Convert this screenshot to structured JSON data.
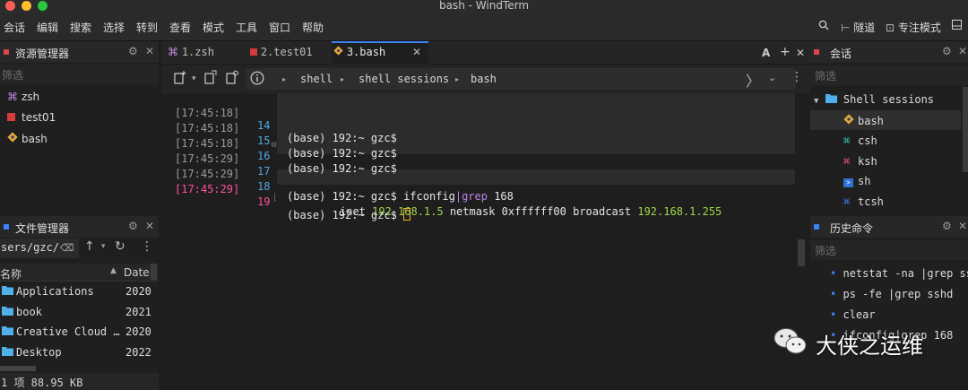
{
  "window": {
    "title": "bash - WindTerm"
  },
  "colors": {
    "accent": "#3b82f6",
    "traffic_red": "#fe5f57",
    "traffic_yellow": "#febc2e",
    "traffic_green": "#28c840",
    "prompt_green": "#9fd84a"
  },
  "menu": [
    "会话",
    "编辑",
    "搜索",
    "选择",
    "转到",
    "查看",
    "模式",
    "工具",
    "窗口",
    "帮助"
  ],
  "menu_right": {
    "search_icon": "search-icon",
    "tunnel": "隧道",
    "focus_mode": "专注模式"
  },
  "explorer": {
    "title": "资源管理器",
    "filter_placeholder": "筛选",
    "items": [
      {
        "label": "zsh",
        "icon": "command-icon"
      },
      {
        "label": "test01",
        "icon": "red-square-icon"
      },
      {
        "label": "bash",
        "icon": "git-icon"
      }
    ]
  },
  "file_manager": {
    "title": "文件管理器",
    "path": "sers/gzc/",
    "col_name": "名称",
    "col_date": "Date",
    "rows": [
      {
        "name": "Applications",
        "date": "2020"
      },
      {
        "name": "book",
        "date": "2021"
      },
      {
        "name": "Creative Cloud …",
        "date": "2020"
      },
      {
        "name": "Desktop",
        "date": "2022"
      }
    ],
    "status": "1 项 88.95 KB"
  },
  "tabs": [
    {
      "label": "1.zsh",
      "icon": "command-icon"
    },
    {
      "label": "2.test01",
      "icon": "red-square-icon"
    },
    {
      "label": "3.bash",
      "icon": "git-icon",
      "close": "✕"
    }
  ],
  "tab_actions": {
    "font": "A",
    "add": "+",
    "close": "✕"
  },
  "breadcrumb": [
    "shell",
    "shell sessions",
    "bash"
  ],
  "terminal": {
    "lines": [
      {
        "ts": "[17:45:18]",
        "num": "14",
        "prompt": "(base) 192:~ gzc$",
        "cmd": ""
      },
      {
        "ts": "[17:45:18]",
        "num": "15",
        "prompt": "(base) 192:~ gzc$",
        "cmd": ""
      },
      {
        "ts": "[17:45:18]",
        "num": "16",
        "prompt": "(base) 192:~ gzc$",
        "cmd": ""
      },
      {
        "ts": "[17:45:29]",
        "num": "17",
        "prompt": "(base) 192:~ gzc$",
        "cmd_a": "ifconfig",
        "cmd_pipe": "|grep",
        "cmd_b": " 168"
      },
      {
        "ts": "[17:45:29]",
        "num": "18",
        "out_a": "inet ",
        "out_ip": "192.168.1.5",
        "out_b": " netmask 0xffffff00 broadcast ",
        "out_bc": "192.168.1.255"
      },
      {
        "ts": "[17:45:29]",
        "num": "19",
        "prompt": "(base) 192:~ gzc$",
        "cmd": ""
      }
    ]
  },
  "sessions": {
    "title": "会话",
    "filter_placeholder": "筛选",
    "group": "Shell sessions",
    "items": [
      {
        "label": "bash",
        "icon": "git-icon"
      },
      {
        "label": "csh",
        "icon": "command-icon"
      },
      {
        "label": "ksh",
        "icon": "command-icon"
      },
      {
        "label": "sh",
        "icon": "powershell-icon"
      },
      {
        "label": "tcsh",
        "icon": "command-icon"
      }
    ]
  },
  "history": {
    "title": "历史命令",
    "filter_placeholder": "筛选",
    "items": [
      "netstat -na |grep ssh",
      "ps -fe |grep sshd",
      "clear",
      "ifconfig|grep 168"
    ]
  },
  "watermark": "大侠之运维"
}
